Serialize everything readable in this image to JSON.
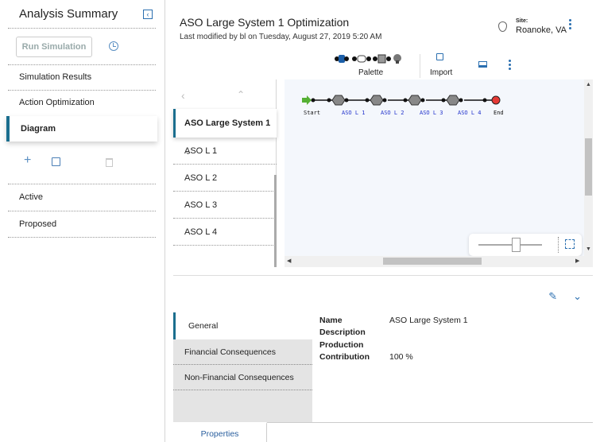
{
  "sidebar": {
    "title": "Analysis Summary",
    "run_button": "Run Simulation",
    "items": [
      {
        "label": "Simulation Results"
      },
      {
        "label": "Action Optimization"
      },
      {
        "label": "Diagram"
      }
    ],
    "states": [
      {
        "label": "Active"
      },
      {
        "label": "Proposed"
      }
    ]
  },
  "header": {
    "title": "ASO Large System 1 Optimization",
    "subtitle": "Last modified by bl on Tuesday, August 27, 2019 5:20 AM",
    "site_label": "Site:",
    "site_value": "Roanoke, VA"
  },
  "toolbar": {
    "palette_label": "Palette",
    "import_label": "Import"
  },
  "tree": {
    "selected": "ASO Large System 1",
    "items": [
      "ASO L 1",
      "ASO L 2",
      "ASO L 3",
      "ASO L 4"
    ]
  },
  "diagram": {
    "nodes": [
      "Start",
      "ASO L 1",
      "ASO L 2",
      "ASO L 3",
      "ASO L 4",
      "End"
    ],
    "colors": {
      "start": "#55b034",
      "end": "#e53935",
      "link": "#2233cc"
    }
  },
  "details": {
    "tabs": [
      "General",
      "Financial Consequences",
      "Non-Financial Consequences"
    ],
    "fields": [
      {
        "key": "Name",
        "value": "ASO Large System 1"
      },
      {
        "key": "Description",
        "value": ""
      },
      {
        "key": "Production",
        "value": ""
      },
      {
        "key": "Contribution",
        "value": "100 %"
      }
    ],
    "footer_tab": "Properties"
  }
}
